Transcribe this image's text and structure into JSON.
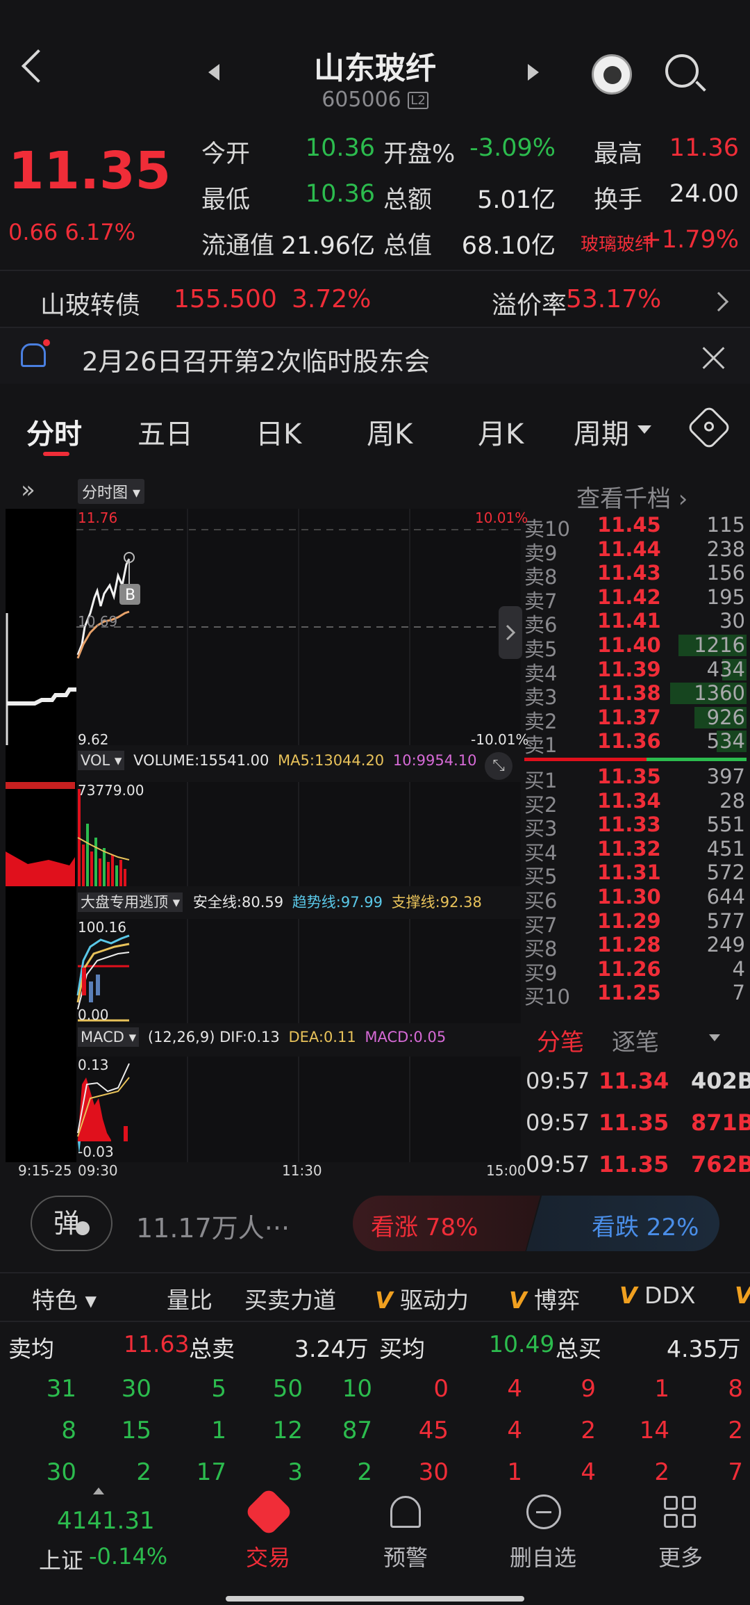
{
  "header": {
    "title": "山东玻纤",
    "code": "605006",
    "badge": "L2"
  },
  "quote": {
    "price": "11.35",
    "change": "0.66",
    "pct": "6.17%",
    "fields": [
      {
        "label": "今开",
        "value": "10.36",
        "color": "green",
        "label2": "开盘%",
        "value2": "-3.09%",
        "color2": "green",
        "label3": "最高",
        "value3": "11.36",
        "color3": "red"
      },
      {
        "label": "最低",
        "value": "10.36",
        "color": "green",
        "label2": "总额",
        "value2": "5.01亿",
        "color2": "white",
        "label3": "换手",
        "value3": "24.00",
        "color3": "white"
      },
      {
        "label": "流通值",
        "value": "21.96亿",
        "color": "white",
        "label2": "总值",
        "value2": "68.10亿",
        "color2": "white",
        "label3": "玻璃玻纤",
        "value3": "+1.79%",
        "color3": "red"
      }
    ]
  },
  "bond": {
    "name": "山玻转债",
    "price": "155.500",
    "pct": "3.72%",
    "premium_label": "溢价率",
    "premium": "53.17%"
  },
  "notice": {
    "text": "2月26日召开第2次临时股东会"
  },
  "tabs": [
    "分时",
    "五日",
    "日K",
    "周K",
    "月K",
    "周期"
  ],
  "chart": {
    "mode": "分时图",
    "high": "11.76",
    "high_pct": "10.01%",
    "low": "9.62",
    "low_pct": "-10.01%",
    "mid": "10.69",
    "marker": "B",
    "vol": {
      "name": "VOL",
      "volume": "VOLUME:15541.00",
      "ma5": "MA5:13044.20",
      "ma10": "10:9954.10",
      "axis": "73779.00"
    },
    "ind": {
      "name": "大盘专用逃顶",
      "safe": "安全线:80.59",
      "trend": "趋势线:97.99",
      "support": "支撑线:92.38",
      "top": "100.16",
      "bottom": "0.00"
    },
    "macd": {
      "name": "MACD",
      "params": "(12,26,9)",
      "dif": "DIF:0.13",
      "dea": "DEA:0.11",
      "macd": "MACD:0.05",
      "top": "0.13",
      "bottom": "-0.03"
    },
    "times": [
      "9:15-25",
      "09:30",
      "11:30",
      "15:00"
    ]
  },
  "book": {
    "link": "查看千档",
    "asks": [
      {
        "l": "卖10",
        "p": "11.45",
        "v": "115",
        "w": 0
      },
      {
        "l": "卖9",
        "p": "11.44",
        "v": "238",
        "w": 0
      },
      {
        "l": "卖8",
        "p": "11.43",
        "v": "156",
        "w": 0
      },
      {
        "l": "卖7",
        "p": "11.42",
        "v": "195",
        "w": 0
      },
      {
        "l": "卖6",
        "p": "11.41",
        "v": "30",
        "w": 0
      },
      {
        "l": "卖5",
        "p": "11.40",
        "v": "1216",
        "w": 0.89
      },
      {
        "l": "卖4",
        "p": "11.39",
        "v": "434",
        "w": 0.32
      },
      {
        "l": "卖3",
        "p": "11.38",
        "v": "1360",
        "w": 1.0
      },
      {
        "l": "卖2",
        "p": "11.37",
        "v": "926",
        "w": 0.68
      },
      {
        "l": "卖1",
        "p": "11.36",
        "v": "534",
        "w": 0.39
      }
    ],
    "bids": [
      {
        "l": "买1",
        "p": "11.35",
        "v": "397"
      },
      {
        "l": "买2",
        "p": "11.34",
        "v": "28"
      },
      {
        "l": "买3",
        "p": "11.33",
        "v": "551"
      },
      {
        "l": "买4",
        "p": "11.32",
        "v": "451"
      },
      {
        "l": "买5",
        "p": "11.31",
        "v": "572"
      },
      {
        "l": "买6",
        "p": "11.30",
        "v": "644"
      },
      {
        "l": "买7",
        "p": "11.29",
        "v": "577"
      },
      {
        "l": "买8",
        "p": "11.28",
        "v": "249"
      },
      {
        "l": "买9",
        "p": "11.26",
        "v": "4"
      },
      {
        "l": "买10",
        "p": "11.25",
        "v": "7"
      }
    ]
  },
  "trades": {
    "tab1": "分笔",
    "tab2": "逐笔",
    "rows": [
      {
        "t": "09:57",
        "p": "11.34",
        "v": "402B"
      },
      {
        "t": "09:57",
        "p": "11.35",
        "v": "871B"
      },
      {
        "t": "09:57",
        "p": "11.35",
        "v": "762B"
      }
    ]
  },
  "sentiment": {
    "danmu": "弹",
    "people": "11.17万人···",
    "up": "看涨 78%",
    "down": "看跌 22%"
  },
  "features": {
    "menu": "特色",
    "items": [
      "量比",
      "买卖力道",
      "驱动力",
      "博弈",
      "DDX"
    ]
  },
  "stats": {
    "sell_avg_label": "卖均",
    "sell_avg": "11.63",
    "sell_total_label": "总卖",
    "sell_total": "3.24万",
    "buy_avg_label": "买均",
    "buy_avg": "10.49",
    "buy_total_label": "总买",
    "buy_total": "4.35万",
    "sell_rows": [
      [
        "31",
        "30",
        "5",
        "50",
        "10"
      ],
      [
        "8",
        "15",
        "1",
        "12",
        "87"
      ],
      [
        "30",
        "2",
        "17",
        "3",
        "2"
      ]
    ],
    "buy_rows": [
      [
        "0",
        "4",
        "9",
        "1",
        "8"
      ],
      [
        "45",
        "4",
        "2",
        "14",
        "2"
      ],
      [
        "30",
        "1",
        "4",
        "2",
        "7"
      ]
    ]
  },
  "index": {
    "value": "4141.31",
    "name": "上证",
    "pct": "-0.14%"
  },
  "nav": [
    "交易",
    "预警",
    "删自选",
    "更多"
  ]
}
